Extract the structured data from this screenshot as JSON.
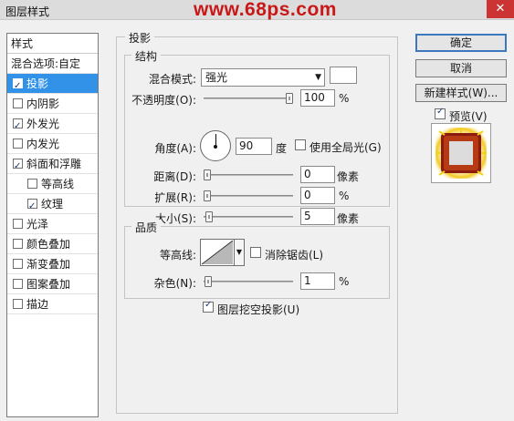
{
  "window": {
    "title": "图层样式",
    "watermark": "www.68ps.com",
    "close_glyph": "✕"
  },
  "stylelist": {
    "header": "样式",
    "blend_options": "混合选项:自定",
    "items": [
      {
        "label": "投影",
        "checked": true,
        "selected": true,
        "level": 0
      },
      {
        "label": "内阴影",
        "checked": false,
        "level": 0
      },
      {
        "label": "外发光",
        "checked": true,
        "level": 0
      },
      {
        "label": "内发光",
        "checked": false,
        "level": 0
      },
      {
        "label": "斜面和浮雕",
        "checked": true,
        "level": 0
      },
      {
        "label": "等高线",
        "checked": false,
        "level": 1
      },
      {
        "label": "纹理",
        "checked": true,
        "level": 1
      },
      {
        "label": "光泽",
        "checked": false,
        "level": 0
      },
      {
        "label": "颜色叠加",
        "checked": false,
        "level": 0
      },
      {
        "label": "渐变叠加",
        "checked": false,
        "level": 0
      },
      {
        "label": "图案叠加",
        "checked": false,
        "level": 0
      },
      {
        "label": "描边",
        "checked": false,
        "level": 0
      }
    ]
  },
  "shadow": {
    "section_title": "投影",
    "structure_title": "结构",
    "blend_mode_label": "混合模式:",
    "blend_mode_value": "强光",
    "shadow_color": "#ffffff",
    "opacity_label": "不透明度(O):",
    "opacity_value": "100",
    "opacity_unit": "%",
    "angle_label": "角度(A):",
    "angle_value": "90",
    "angle_unit": "度",
    "global_light_label": "使用全局光(G)",
    "global_light_checked": false,
    "distance_label": "距离(D):",
    "distance_value": "0",
    "distance_unit": "像素",
    "spread_label": "扩展(R):",
    "spread_value": "0",
    "spread_unit": "%",
    "size_label": "大小(S):",
    "size_value": "5",
    "size_unit": "像素",
    "quality_title": "品质",
    "contour_label": "等高线:",
    "antialias_label": "消除锯齿(L)",
    "antialias_checked": false,
    "noise_label": "杂色(N):",
    "noise_value": "1",
    "noise_unit": "%",
    "knockout_label": "图层挖空投影(U)",
    "knockout_checked": true
  },
  "buttons": {
    "ok": "确定",
    "cancel": "取消",
    "new_style": "新建样式(W)...",
    "preview_label": "预览(V)",
    "preview_checked": true
  },
  "colors": {
    "selection": "#3292e8",
    "watermark": "#c81818",
    "preview_frame": "#8b1a10",
    "preview_glow": "#f2c40a"
  }
}
